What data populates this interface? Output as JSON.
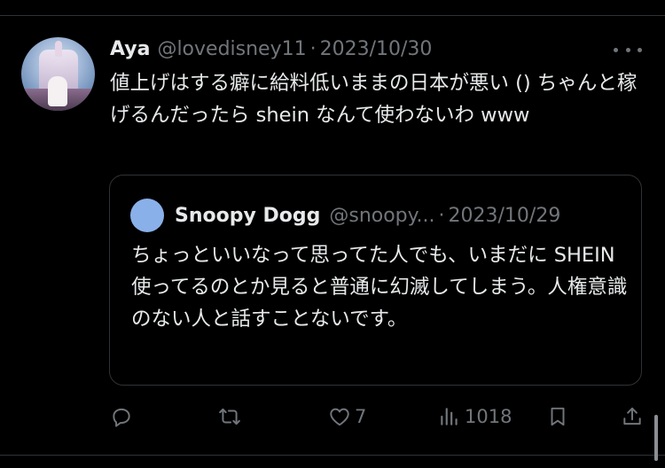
{
  "post": {
    "display_name": "Aya",
    "handle": "@lovedisney11",
    "separator": "·",
    "date": "2023/10/30",
    "text": "値上げはする癖に給料低いままの日本が悪い () ちゃんと稼げるんだったら shein なんて使わないわ www"
  },
  "quoted": {
    "display_name": "Snoopy Dogg",
    "handle": "@snoopy...",
    "separator": "·",
    "date": "2023/10/29",
    "text": "ちょっといいなって思ってた人でも、いまだに SHEIN 使ってるのとか見ると普通に幻滅してしまう。人権意識のない人と話すことないです。"
  },
  "actions": {
    "reply_icon": "reply-icon",
    "repost_icon": "repost-icon",
    "like_icon": "heart-icon",
    "like_count": "7",
    "views_icon": "views-icon",
    "views_count": "1018",
    "bookmark_icon": "bookmark-icon",
    "share_icon": "share-icon"
  },
  "colors": {
    "background": "#000000",
    "text": "#e7e9ea",
    "secondary": "#71767b",
    "border": "#2f3336",
    "quoted_avatar": "#8ab0ea"
  }
}
